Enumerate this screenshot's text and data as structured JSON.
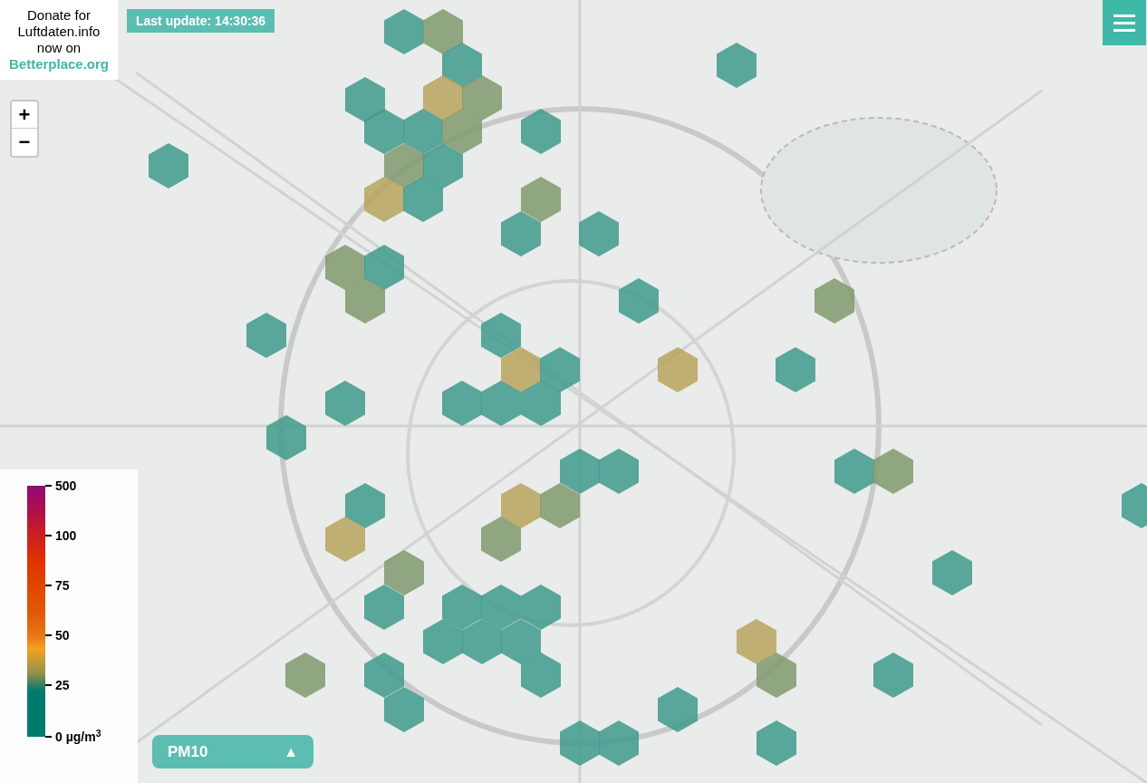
{
  "donate": {
    "text": "Donate for Luftdaten.info now on",
    "link": "Betterplace.org"
  },
  "last_update": "Last update: 14:30:36",
  "zoom": {
    "in": "+",
    "out": "−"
  },
  "legend": {
    "ticks": [
      "500",
      "100",
      "75",
      "50",
      "25",
      "0 µg/m$^{3}$"
    ]
  },
  "measure_selector": {
    "label": "PM10",
    "caret": "▲"
  }
}
